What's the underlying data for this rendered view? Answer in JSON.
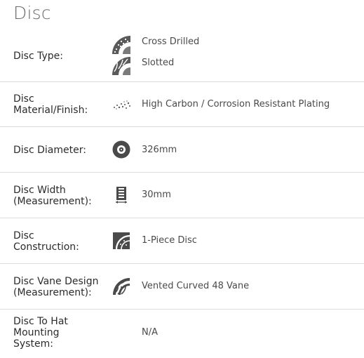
{
  "section": {
    "title": "Disc"
  },
  "specs": [
    {
      "label": "Disc Type:",
      "values": [
        "Cross Drilled",
        "Slotted"
      ],
      "icons": [
        "cross-drilled-disc-icon",
        "slotted-disc-icon"
      ]
    },
    {
      "label": "Disc Material/Finish:",
      "label_lines": [
        "Disc",
        "Material/Finish:"
      ],
      "value": "High Carbon / Corrosion Resistant Plating",
      "icon": "carbon-particles-icon"
    },
    {
      "label": "Disc Diameter:",
      "value": "326mm",
      "icon": "disc-diameter-icon"
    },
    {
      "label": "Disc Width (Measurement):",
      "label_lines": [
        "Disc Width",
        "(Measurement):"
      ],
      "value": "30mm",
      "icon": "disc-width-icon"
    },
    {
      "label": "Disc Construction:",
      "label_lines": [
        "Disc",
        "Construction:"
      ],
      "value": "1-Piece Disc",
      "icon": "one-piece-disc-icon"
    },
    {
      "label": "Disc Vane Design (Measurement):",
      "label_lines": [
        "Disc Vane Design",
        "(Measurement):"
      ],
      "value": "Vented Curved 48 Vane",
      "icon": "curved-vane-icon"
    },
    {
      "label": "Disc To Hat Mounting System:",
      "label_lines": [
        "Disc To Hat",
        "Mounting",
        "System:"
      ],
      "value": "N/A"
    }
  ],
  "colors": {
    "divider": "#dcdcdc",
    "icon_dark": "#3a3a3a",
    "icon_light": "#8a8a8a"
  }
}
